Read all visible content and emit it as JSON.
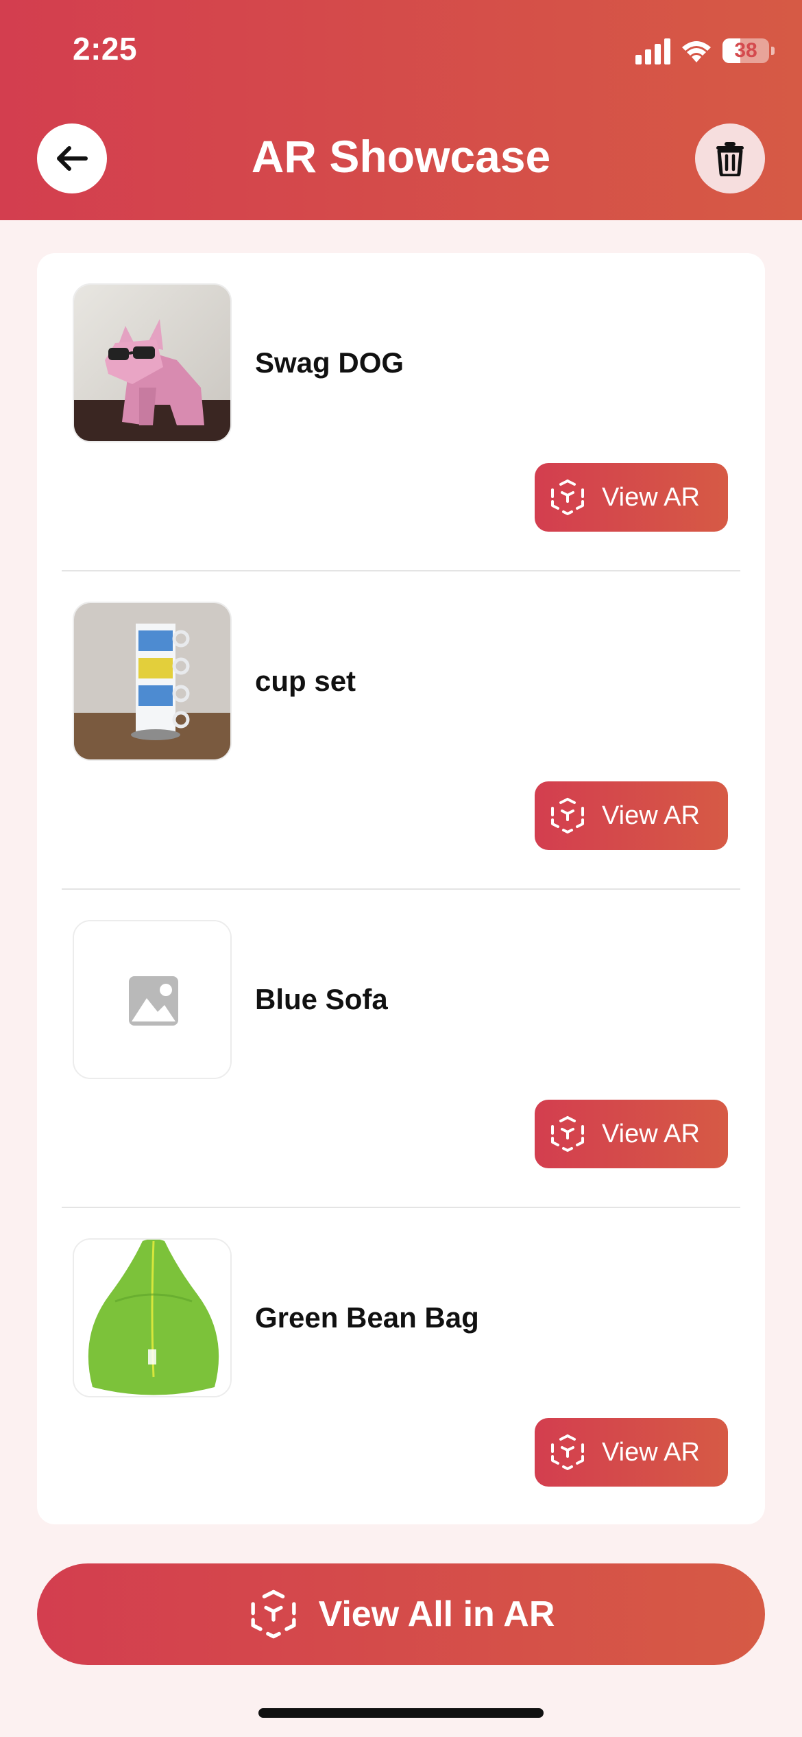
{
  "status_bar": {
    "time": "2:25",
    "battery": "38"
  },
  "header": {
    "title": "AR Showcase"
  },
  "items": [
    {
      "name": "Swag DOG",
      "thumbnail": "pink-dog-figure",
      "button_label": "View AR"
    },
    {
      "name": "cup set",
      "thumbnail": "stacked-cups",
      "button_label": "View AR"
    },
    {
      "name": "Blue Sofa",
      "thumbnail": "image-placeholder-icon",
      "button_label": "View AR"
    },
    {
      "name": "Green Bean Bag",
      "thumbnail": "green-bean-bag",
      "button_label": "View AR"
    }
  ],
  "footer": {
    "view_all_label": "View All in AR"
  },
  "colors": {
    "accent_start": "#d33e4f",
    "accent_end": "#d65a45",
    "background": "#fcf1f1"
  }
}
